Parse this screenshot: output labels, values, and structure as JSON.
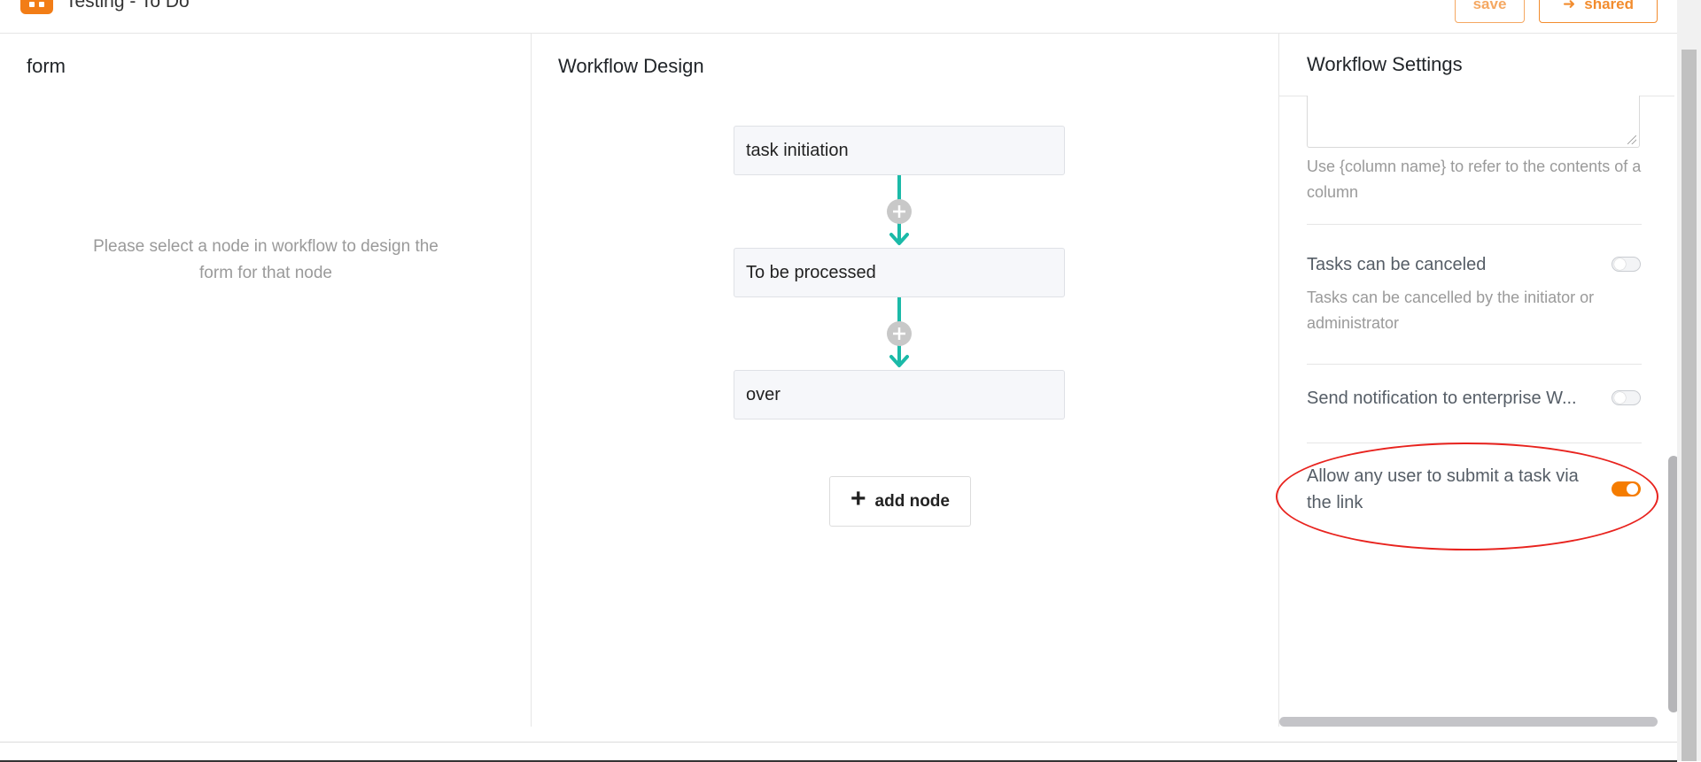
{
  "header": {
    "doc_title": "Testing - To Do",
    "save_label": "save",
    "shared_label": "shared",
    "brand_color": "#f27d16"
  },
  "form_panel": {
    "title": "form",
    "hint": "Please select a node in workflow to design the form for that node"
  },
  "workflow_panel": {
    "title": "Workflow Design",
    "nodes": [
      "task initiation",
      "To be processed",
      "over"
    ],
    "add_node_label": "add node",
    "connector_color": "#1bbaa8"
  },
  "settings_panel": {
    "title": "Workflow Settings",
    "template_hint": "Use {column name} to refer to the contents of a column",
    "settings": [
      {
        "label": "Tasks can be canceled",
        "description": "Tasks can be cancelled by the initiator or administrator",
        "enabled": false
      },
      {
        "label": "Send notification to enterprise W...",
        "enabled": false
      },
      {
        "label": "Allow any user to submit a task via the link",
        "enabled": true,
        "toggle_color": "#f57c00"
      }
    ]
  },
  "annotation": {
    "shape": "ellipse",
    "color": "#e8231e"
  }
}
